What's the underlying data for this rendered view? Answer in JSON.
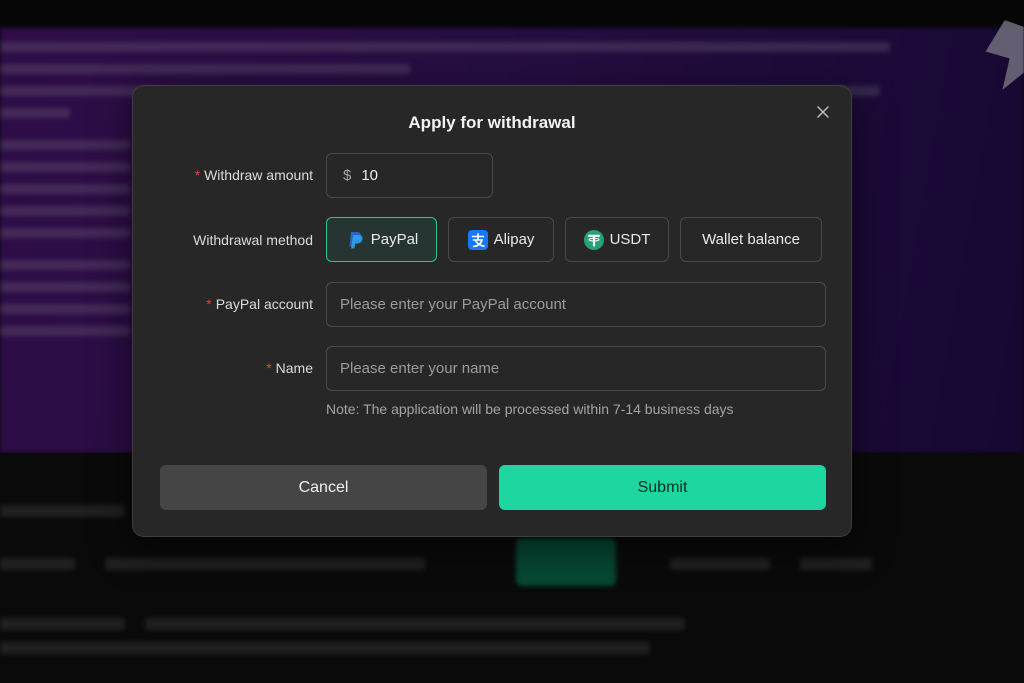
{
  "modal": {
    "title": "Apply for withdrawal",
    "fields": {
      "amount": {
        "label": "Withdraw amount",
        "currency_symbol": "$",
        "value": "10",
        "required": true
      },
      "method": {
        "label": "Withdrawal method",
        "options": [
          {
            "label": "PayPal",
            "icon": "paypal-icon",
            "selected": true
          },
          {
            "label": "Alipay",
            "icon": "alipay-icon",
            "selected": false
          },
          {
            "label": "USDT",
            "icon": "usdt-icon",
            "selected": false
          },
          {
            "label": "Wallet balance",
            "icon": "",
            "selected": false
          }
        ]
      },
      "paypal_account": {
        "label": "PayPal account",
        "value": "",
        "placeholder": "Please enter your PayPal account",
        "required": true
      },
      "name": {
        "label": "Name",
        "value": "",
        "placeholder": "Please enter your name",
        "required": true
      }
    },
    "required_mark": "*",
    "note": "Note: The application will be processed within 7-14 business days",
    "buttons": {
      "cancel": "Cancel",
      "submit": "Submit"
    }
  },
  "colors": {
    "accent": "#1ed6a0",
    "selected_border": "#1ec99a",
    "required": "#e0443e",
    "modal_bg": "#272727",
    "backdrop_purple": "#4a1b7e"
  }
}
